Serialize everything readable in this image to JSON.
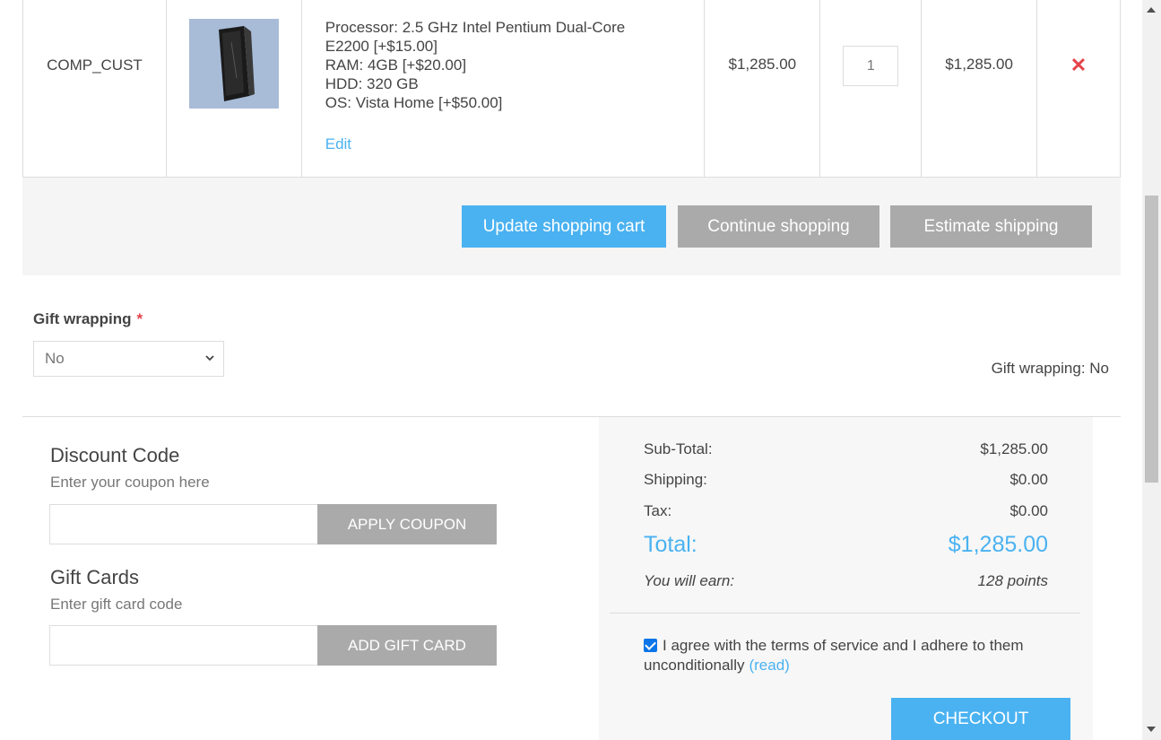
{
  "cart": {
    "item": {
      "sku": "COMP_CUST",
      "image_alt": "computer-tower",
      "attributes": [
        "Processor: 2.5 GHz Intel Pentium Dual-Core",
        "E2200 [+$15.00]",
        "RAM: 4GB [+$20.00]",
        "HDD: 320 GB",
        "OS: Vista Home [+$50.00]"
      ],
      "edit_label": "Edit",
      "unit_price": "$1,285.00",
      "quantity": "1",
      "subtotal": "$1,285.00",
      "remove_glyph": "✕"
    },
    "buttons": {
      "update": "Update shopping cart",
      "continue": "Continue shopping",
      "estimate": "Estimate shipping"
    }
  },
  "gift_wrapping": {
    "label": "Gift wrapping",
    "required_mark": "*",
    "selected": "No",
    "summary": "Gift wrapping: No"
  },
  "discount": {
    "title": "Discount Code",
    "hint": "Enter your coupon here",
    "value": "",
    "button": "APPLY COUPON"
  },
  "gift_cards": {
    "title": "Gift Cards",
    "hint": "Enter gift card code",
    "value": "",
    "button": "ADD GIFT CARD"
  },
  "totals": {
    "subtotal_label": "Sub-Total:",
    "subtotal_value": "$1,285.00",
    "shipping_label": "Shipping:",
    "shipping_value": "$0.00",
    "tax_label": "Tax:",
    "tax_value": "$0.00",
    "total_label": "Total:",
    "total_value": "$1,285.00",
    "earn_label": "You will earn:",
    "earn_value": "128 points"
  },
  "terms": {
    "checked": true,
    "text": "I agree with the terms of service and I adhere to them unconditionally",
    "read_link": "(read)"
  },
  "checkout_label": "CHECKOUT",
  "colors": {
    "accent": "#4ab2f1",
    "button_gray": "#aaaaaa",
    "remove_red": "#e4434b",
    "panel_bg": "#f5f5f5"
  }
}
